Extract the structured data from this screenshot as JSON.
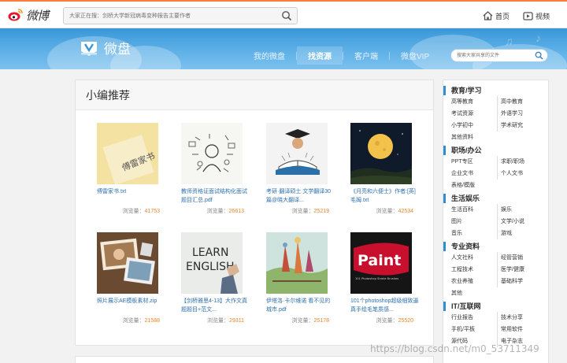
{
  "topbar": {
    "logo_text": "微博",
    "search_placeholder": "大家正在搜：剑桥大学新冠病毒变种报告主要作者",
    "links": [
      {
        "label": "首页",
        "icon": "home-icon"
      },
      {
        "label": "视频",
        "icon": "video-icon"
      }
    ]
  },
  "banner": {
    "title": "微盘",
    "nav": [
      {
        "label": "我的微盘",
        "active": false
      },
      {
        "label": "找资源",
        "active": true
      },
      {
        "label": "客户端",
        "active": false
      },
      {
        "label": "微盘VIP",
        "active": false
      }
    ],
    "search_placeholder": "搜索大家共享的文件"
  },
  "main": {
    "heading": "小编推荐",
    "views_label": "浏览量：",
    "items": [
      {
        "title": "傅雷家书.txt",
        "views": "41753",
        "thumb": "book-cover"
      },
      {
        "title": "教师资格证面试结构化面试题目汇总.pdf",
        "views": "26613",
        "thumb": "sketch-doodle"
      },
      {
        "title": "考研·翻译硕士 文学翻译30篇@晓大翻译...",
        "views": "25219",
        "thumb": "graduate-reading"
      },
      {
        "title": "《月亮和六便士》作者:[英]毛姆.txt",
        "views": "42534",
        "thumb": "moon-night"
      },
      {
        "title": "照片展示AE模板素材.zip",
        "views": "21588",
        "thumb": "photo-frames"
      },
      {
        "title": "【剑桥雅思4-13】大作文真题题目+范文...",
        "views": "29311",
        "thumb": "learn-english"
      },
      {
        "title": "伊塔洛·卡尔维诺 看不见的城市.pdf",
        "views": "25178",
        "thumb": "fantasy-city"
      },
      {
        "title": "101个photoshop超级细致逼真手绘毛笔质感...",
        "views": "25520",
        "thumb": "paint-poster"
      }
    ],
    "thumb_text": {
      "book": "傅雷家书",
      "english_1": "LEARN",
      "english_2": "ENGLISH",
      "paint": "Paint",
      "paint_sub": "101 Photoshop Stroke Brushes"
    }
  },
  "sidebar": {
    "categories": [
      {
        "title": "教育/学习",
        "links": [
          "高等教育",
          "高中教育",
          "考试资源",
          "外语学习",
          "小学初中",
          "学术研究",
          "其他资料"
        ]
      },
      {
        "title": "职场/办公",
        "links": [
          "PPT专区",
          "求职/职场",
          "企业文书",
          "个人文书",
          "表格/模版"
        ]
      },
      {
        "title": "生活娱乐",
        "links": [
          "生活百科",
          "娱乐",
          "图片",
          "文学/小说",
          "音乐",
          "游戏"
        ]
      },
      {
        "title": "专业资料",
        "links": [
          "人文社科",
          "经管营销",
          "工程技术",
          "医学/健康",
          "农业养殖",
          "基础科学",
          "其他"
        ]
      },
      {
        "title": "IT/互联网",
        "links": [
          "行业报告",
          "技术分享",
          "手机/平板",
          "常用软件",
          "源代码",
          "电子杂志"
        ]
      }
    ]
  },
  "watermark": "https://blog.csdn.net/m0_53711349",
  "colors": {
    "accent_orange": "#fa7d3c",
    "banner_blue": "#3a97d8",
    "link_blue": "#2d6fae",
    "views_orange": "#e8842b",
    "sidebar_marker": "#2f8dd3"
  }
}
